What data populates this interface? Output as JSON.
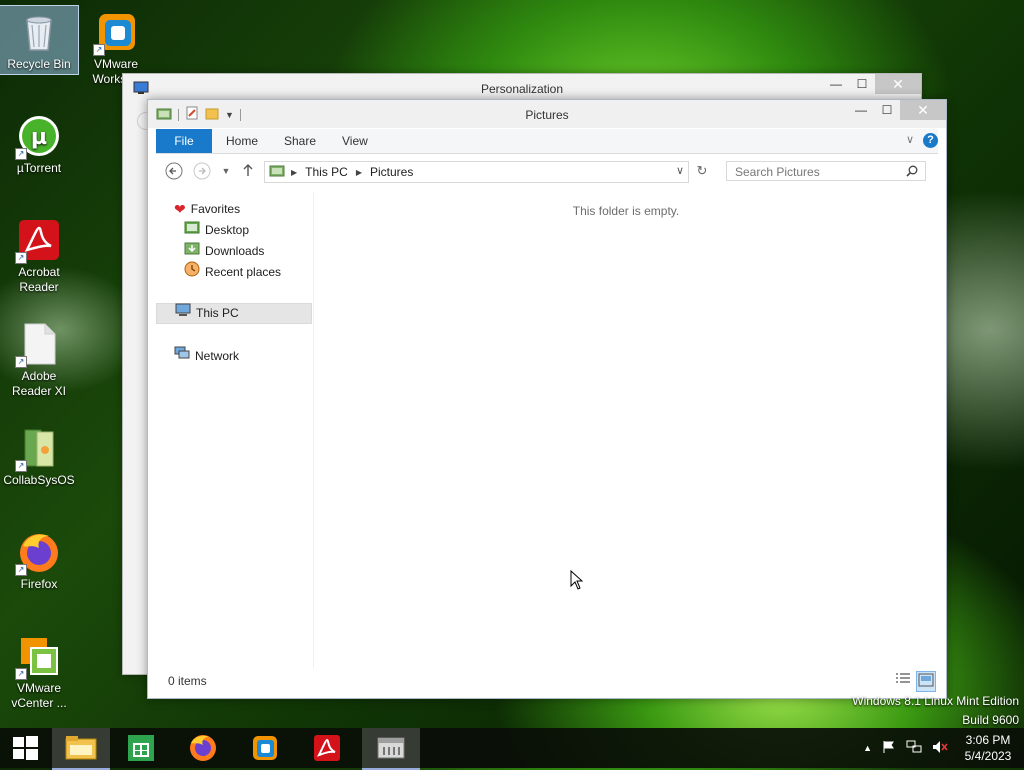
{
  "desktop": {
    "icons": [
      {
        "label": "Recycle Bin"
      },
      {
        "label": "VMware Workst..."
      },
      {
        "label": "µTorrent"
      },
      {
        "label": "Acrobat Reader"
      },
      {
        "label": "Adobe Reader XI"
      },
      {
        "label": "CollabSysOS"
      },
      {
        "label": "Firefox"
      },
      {
        "label": "VMware vCenter ..."
      }
    ],
    "watermark_line1": "Windows 8.1 Linux Mint Edition",
    "watermark_line2": "Build 9600"
  },
  "back_window": {
    "title": "Personalization"
  },
  "explorer": {
    "title": "Pictures",
    "tabs": [
      "File",
      "Home",
      "Share",
      "View"
    ],
    "breadcrumb": [
      "This PC",
      "Pictures"
    ],
    "search_placeholder": "Search Pictures",
    "nav": {
      "favorites": "Favorites",
      "desktop": "Desktop",
      "downloads": "Downloads",
      "recent": "Recent places",
      "this_pc": "This PC",
      "network": "Network"
    },
    "empty_message": "This folder is empty.",
    "status": "0 items"
  },
  "taskbar": {
    "time": "3:06 PM",
    "date": "5/4/2023"
  },
  "colors": {
    "ribbon_file_tab": "#1979ca",
    "close_button": "#c7c7c7",
    "accent": "#1979ca"
  }
}
